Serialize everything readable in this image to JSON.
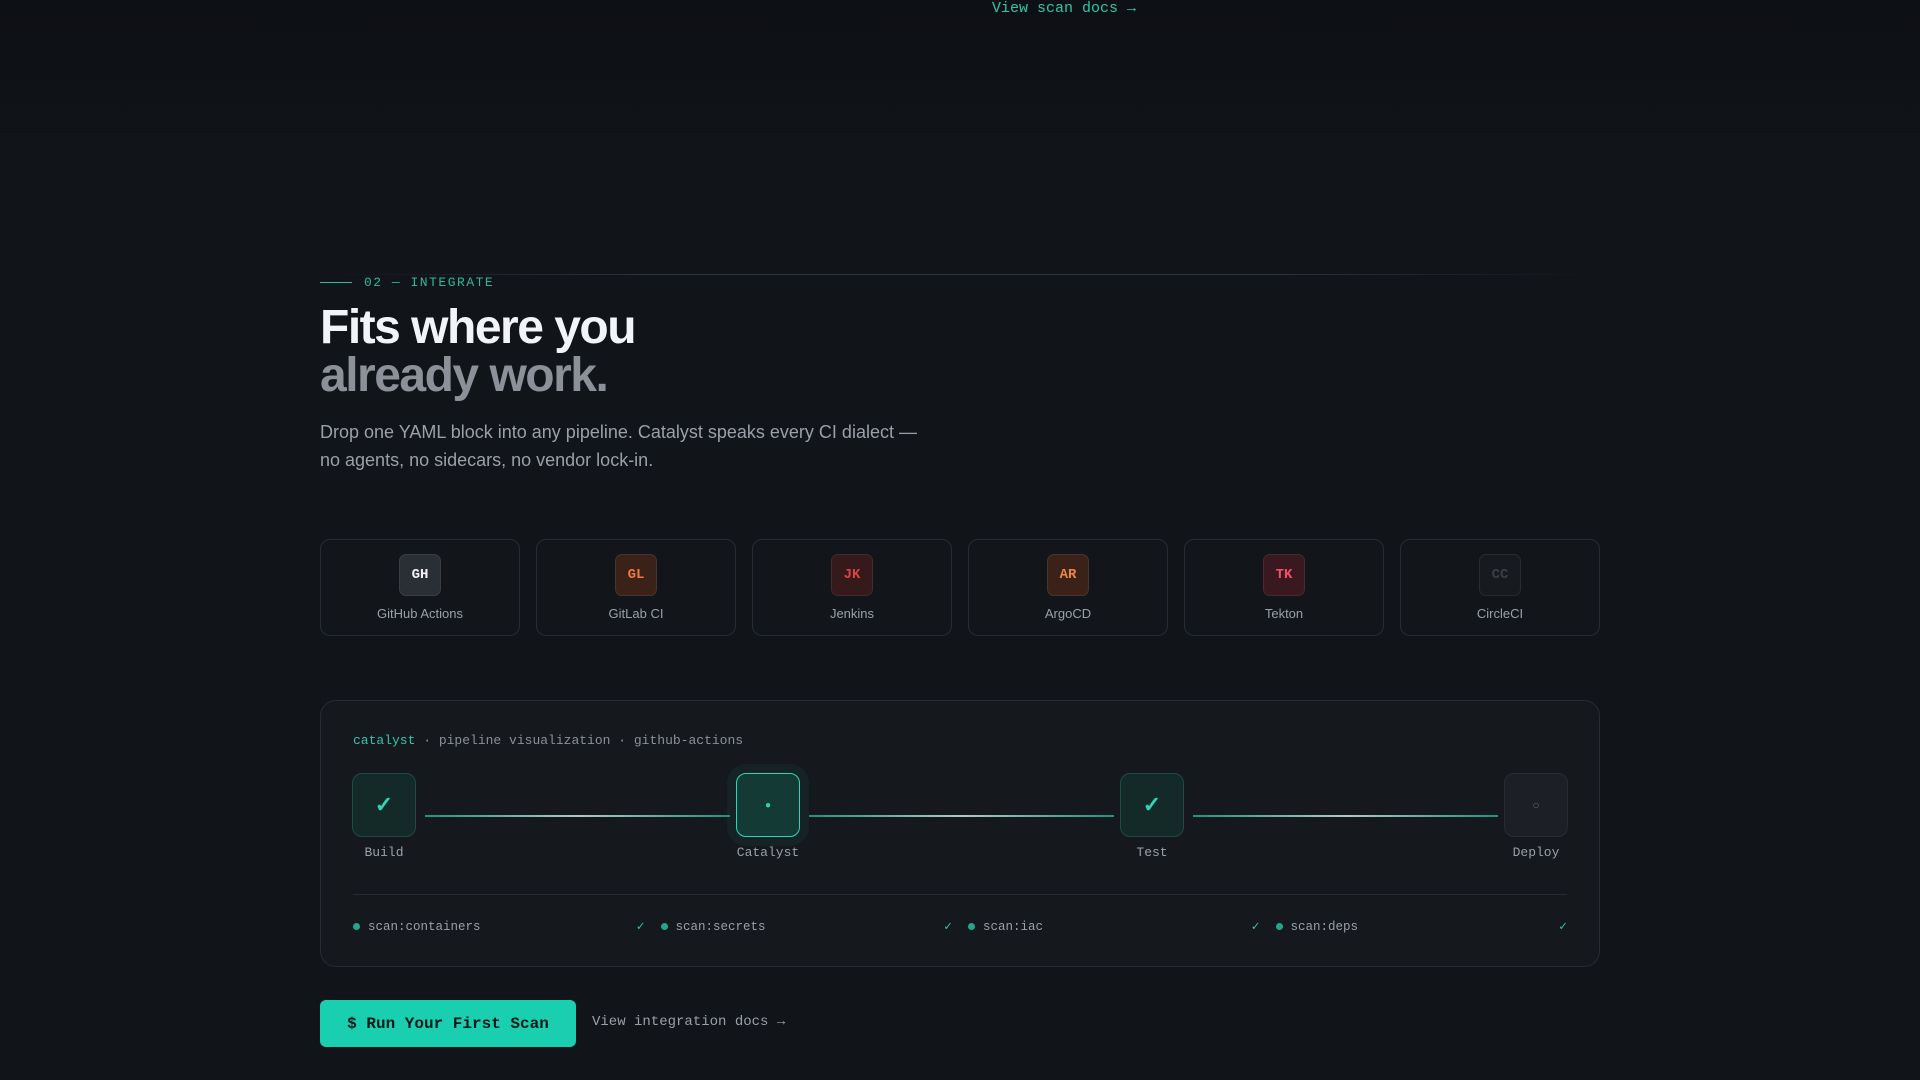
{
  "top_link": "View scan docs →",
  "section": {
    "eyebrow": "02 — INTEGRATE",
    "headline_line1": "Fits where you",
    "headline_line2": "already work.",
    "lede": "Drop one YAML block into any pipeline. Catalyst speaks every CI dialect — no agents, no sidecars, no vendor lock-in."
  },
  "integrations": [
    {
      "abbr": "GH",
      "name": "GitHub Actions",
      "badge_bg": "#2a2e35",
      "badge_fg": "#f2f4f7"
    },
    {
      "abbr": "GL",
      "name": "GitLab CI",
      "badge_bg": "#3a2219",
      "badge_fg": "#f07a3c"
    },
    {
      "abbr": "JK",
      "name": "Jenkins",
      "badge_bg": "#35191b",
      "badge_fg": "#d9443f"
    },
    {
      "abbr": "AR",
      "name": "ArgoCD",
      "badge_bg": "#3a2219",
      "badge_fg": "#f0844a"
    },
    {
      "abbr": "TK",
      "name": "Tekton",
      "badge_bg": "#3a1820",
      "badge_fg": "#f2506a"
    },
    {
      "abbr": "CC",
      "name": "CircleCI",
      "badge_bg": "#171a1f",
      "badge_fg": "#3a3f46"
    }
  ],
  "pipeline": {
    "head_brand": "catalyst",
    "head_rest": " · pipeline visualization · github-actions",
    "stages": [
      {
        "label": "Build",
        "state": "done",
        "glyph": "✓"
      },
      {
        "label": "Catalyst",
        "state": "active",
        "glyph": "●"
      },
      {
        "label": "Test",
        "state": "done",
        "glyph": "✓"
      },
      {
        "label": "Deploy",
        "state": "pending",
        "glyph": "○"
      }
    ],
    "checks": [
      {
        "label": "scan:containers",
        "status": "✓"
      },
      {
        "label": "scan:secrets",
        "status": "✓"
      },
      {
        "label": "scan:iac",
        "status": "✓"
      },
      {
        "label": "scan:deps",
        "status": "✓"
      }
    ]
  },
  "cta": {
    "primary": "$ Run Your First Scan",
    "secondary": "View integration docs →"
  },
  "colors": {
    "accent": "#19cfb0",
    "background": "#111419"
  }
}
